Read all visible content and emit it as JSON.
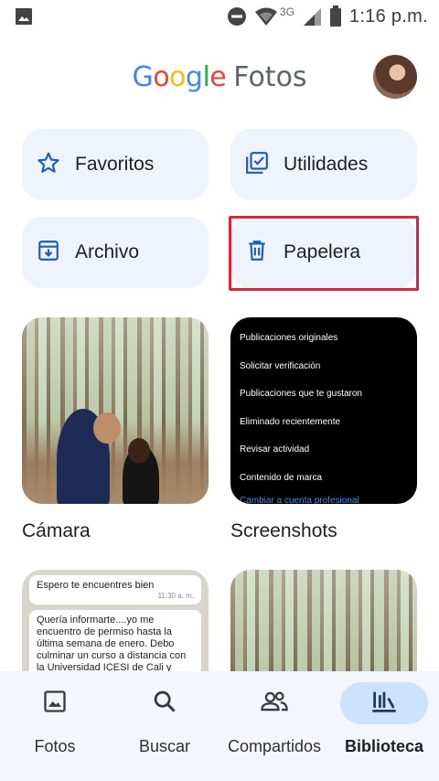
{
  "status_bar": {
    "network_label": "3G",
    "time": "1:16 p.m."
  },
  "header": {
    "logo_text": "Google",
    "title": "Fotos"
  },
  "tiles": {
    "favoritos": "Favoritos",
    "utilidades": "Utilidades",
    "archivo": "Archivo",
    "papelera": "Papelera"
  },
  "albums": {
    "camara": {
      "label": "Cámara"
    },
    "screenshots": {
      "label": "Screenshots",
      "menu_items": [
        "Publicaciones originales",
        "Solicitar verificación",
        "Publicaciones que te gustaron",
        "Eliminado recientemente",
        "Revisar actividad",
        "Contenido de marca"
      ],
      "link": "Cambiar a cuenta profesional"
    },
    "chat": {
      "bubble1": "Espero te encuentres bien",
      "bubble1_time": "11:30 a. m.",
      "bubble2": "Quería informarte....yo me encuentro de permiso hasta la última semana de enero. Debo culminar un curso a distancia con la Universidad ICESI de Cali y viajar para gestionar"
    }
  },
  "bottom_nav": {
    "fotos": "Fotos",
    "buscar": "Buscar",
    "compartidos": "Compartidos",
    "biblioteca": "Biblioteca",
    "active": "biblioteca"
  },
  "colors": {
    "tile_bg": "#eef3fc",
    "accent_blue": "#1a5fb4",
    "highlight_red": "#d7263d",
    "nav_active_pill": "#cde3fb"
  }
}
